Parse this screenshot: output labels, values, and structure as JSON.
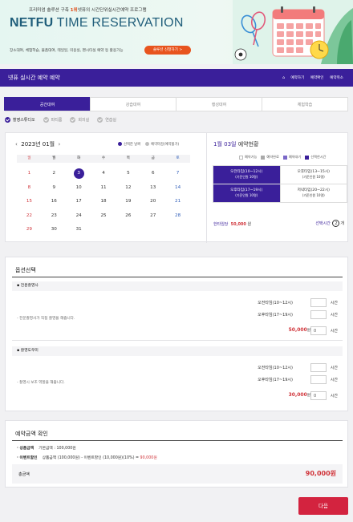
{
  "banner": {
    "sub_prefix": "프리미엄 솔루션 구축",
    "sub_highlight": "1위",
    "sub_suffix": "넷퓨의 시간단위실시간예약 프로그램",
    "title_bold": "NETFU",
    "title_rest": " TIME RESERVATION",
    "desc": "장소대여, 체험학습, 물품대여, 테일일, 미용실, 펜시타실 예약 등 활용가능",
    "cta": "솔루션 신청하기 >"
  },
  "header": {
    "title": "넷퓨 실시간 예약 예약",
    "crumbs": [
      "⌂",
      "예약하기",
      "예약확인",
      "예약취소"
    ]
  },
  "tabs": [
    {
      "label": "공간대여",
      "active": true
    },
    {
      "label": "강습대여",
      "active": false
    },
    {
      "label": "행성대여",
      "active": false
    },
    {
      "label": "체험학습",
      "active": false
    }
  ],
  "sub_options": [
    {
      "label": "촬영스튜디오",
      "active": true
    },
    {
      "label": "파티룸",
      "active": false
    },
    {
      "label": "회의실",
      "active": false
    },
    {
      "label": "연습실",
      "active": false
    }
  ],
  "calendar": {
    "prev": "‹",
    "month": "2023년 01월",
    "next": "›",
    "legend_selected": "선택한 날짜",
    "legend_unavailable": "예약마감(예약불가)",
    "weekdays": [
      "일",
      "월",
      "화",
      "수",
      "목",
      "금",
      "토"
    ],
    "weeks": [
      [
        "1",
        "2",
        "3",
        "4",
        "5",
        "6",
        "7"
      ],
      [
        "8",
        "9",
        "10",
        "11",
        "12",
        "13",
        "14"
      ],
      [
        "15",
        "16",
        "17",
        "18",
        "19",
        "20",
        "21"
      ],
      [
        "22",
        "23",
        "24",
        "25",
        "26",
        "27",
        "28"
      ],
      [
        "29",
        "30",
        "31",
        "",
        "",
        "",
        ""
      ]
    ],
    "selected": "3"
  },
  "reservation": {
    "date": "1월 03일",
    "title_suffix": " 예약현황",
    "legend": [
      "예약가능",
      "예약완료",
      "예약대기",
      "선택한시간"
    ],
    "legend_colors": [
      "#ffffff",
      "#a9a9a9",
      "#7b68c8",
      "#3a1f9a"
    ],
    "slots": [
      {
        "name": "오전타임(10~12시)",
        "note": "(기준인원 10명)",
        "selected": true
      },
      {
        "name": "오후타임(13~15시)",
        "note": "(기준인원 10명)",
        "selected": false
      },
      {
        "name": "오후타임(17~19시)",
        "note": "(기준인원 10명)",
        "selected": true
      },
      {
        "name": "저녁타임(20~22시)",
        "note": "(기준인원 10명)",
        "selected": false
      }
    ],
    "unit_price_label": "한타임당",
    "unit_price": "50,000",
    "unit_price_suffix": "원",
    "selected_time_label": "선택시간",
    "selected_count": "2",
    "selected_time_suffix": "개"
  },
  "options": {
    "title": "옵션선택",
    "groups": [
      {
        "name": "전문촬영사",
        "note": "- 전문촬영사가 직접 촬영을 해줍니다.",
        "rows": [
          "오전타임(10~12시)",
          "오후타임(17~19시)"
        ],
        "unit": "시간",
        "price": "50,000",
        "price_suffix": "원",
        "qty": "0",
        "qty_unit": "시간"
      },
      {
        "name": "촬영도우미",
        "note": "- 촬영시 보조 역할을 해줍니다.",
        "rows": [
          "오전타임(10~12시)",
          "오후타임(17~19시)"
        ],
        "unit": "시간",
        "price": "30,000",
        "price_suffix": "원",
        "qty": "0",
        "qty_unit": "시간"
      }
    ]
  },
  "confirm": {
    "title": "예약금액 확인",
    "row1_label": "· 상품금액",
    "row1_value": "기본금액 : 100,000원",
    "row2_label": "· 이벤트할인",
    "row2_value": "상품금액 (100,000원) - 이벤트할인 (10,000원)(10%) = ",
    "row2_result": "90,000원",
    "total_label": "총금액",
    "total_value": "90,000원"
  },
  "next_button": "다음",
  "colors": {
    "primary": "#3a1f9a",
    "accent": "#d3233f",
    "price": "#d0343a"
  }
}
